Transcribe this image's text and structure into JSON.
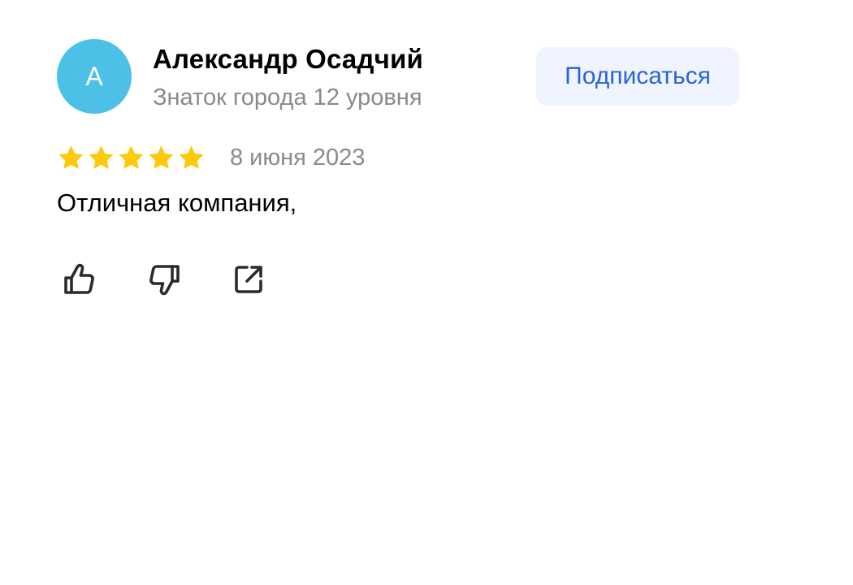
{
  "review": {
    "author": {
      "avatar_letter": "А",
      "avatar_color": "#4dc0e8",
      "name": "Александр Осадчий",
      "level": "Знаток города 12 уровня"
    },
    "subscribe_label": "Подписаться",
    "rating": {
      "stars": 5,
      "max": 5,
      "color": "#fcc90b"
    },
    "date": "8 июня 2023",
    "text": "Отличная компания,",
    "actions": [
      {
        "icon": "thumbs-up-icon"
      },
      {
        "icon": "thumbs-down-icon"
      },
      {
        "icon": "share-icon"
      }
    ]
  },
  "colors": {
    "accent_text": "#2a64d6",
    "button_bg": "#eff4fe",
    "secondary_text": "#8a8a8a"
  }
}
